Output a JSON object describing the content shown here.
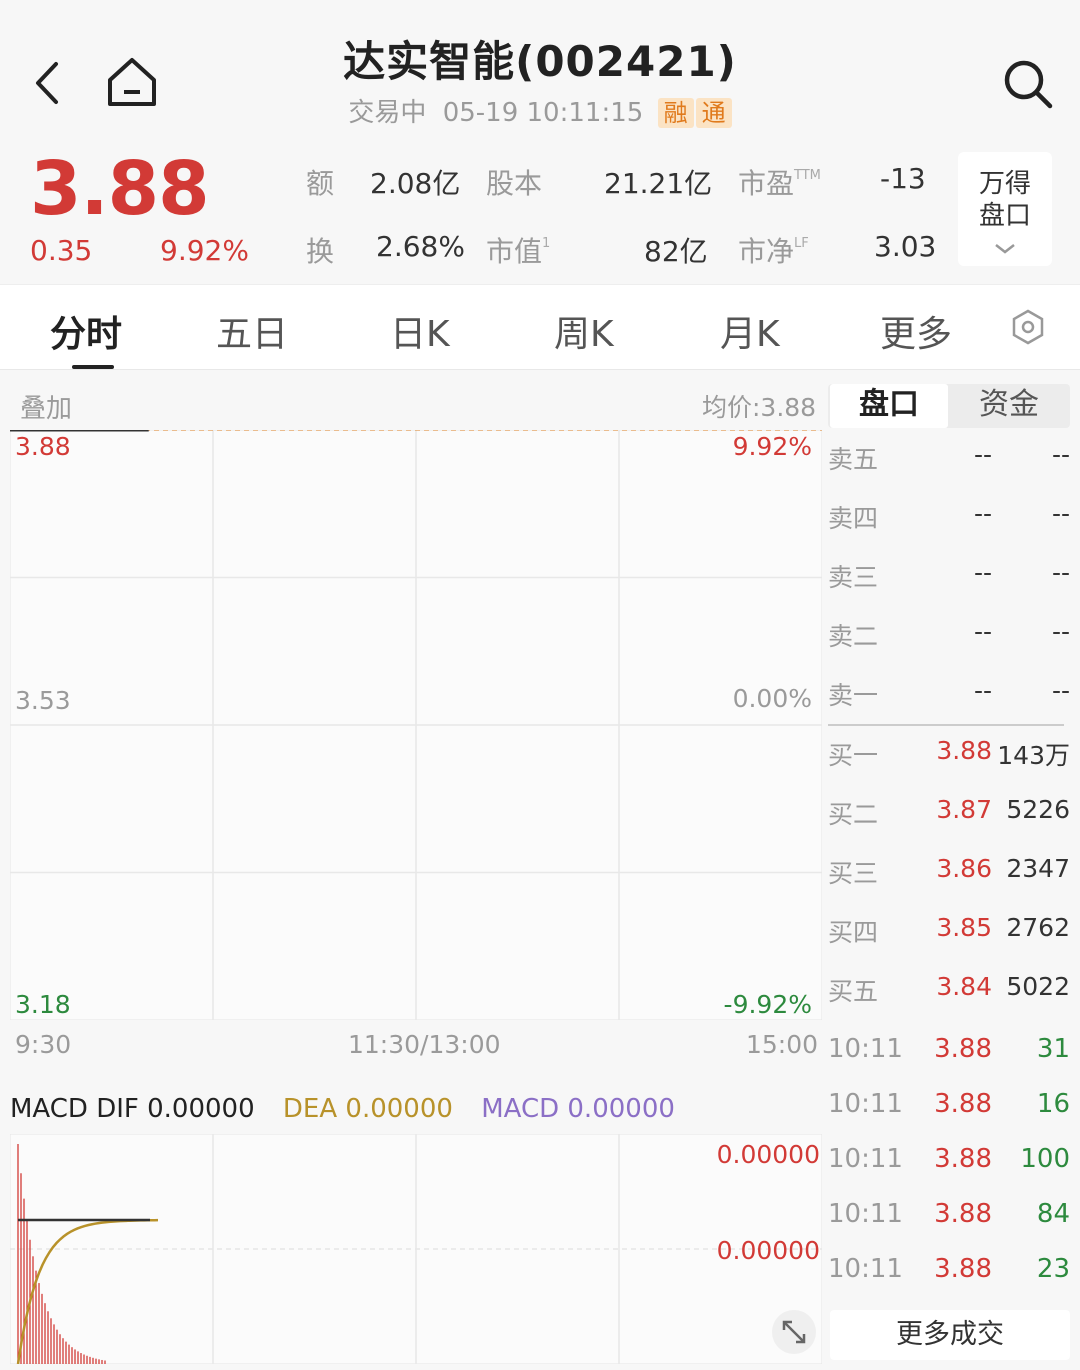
{
  "header": {
    "title": "达实智能(002421)",
    "status": "交易中",
    "datetime": "05-19 10:11:15",
    "tags": [
      "融",
      "通"
    ]
  },
  "quote": {
    "price": "3.88",
    "change": "0.35",
    "change_pct": "9.92%",
    "stats": [
      {
        "label": "额",
        "sup": "",
        "value": "2.08亿"
      },
      {
        "label": "股本",
        "sup": "",
        "value": "21.21亿"
      },
      {
        "label": "市盈",
        "sup": "TTM",
        "value": "-13"
      },
      {
        "label": "换",
        "sup": "",
        "value": "2.68%"
      },
      {
        "label": "市值",
        "sup": "1",
        "value": "82亿"
      },
      {
        "label": "市净",
        "sup": "LF",
        "value": "3.03"
      }
    ],
    "pankou_button": {
      "line1": "万得",
      "line2": "盘口"
    }
  },
  "tabs": [
    "分时",
    "五日",
    "日K",
    "周K",
    "月K",
    "更多"
  ],
  "active_tab": 0,
  "chart_header": {
    "overlay_label": "叠加",
    "avg_price": "均价:3.88"
  },
  "chart_data": {
    "type": "line",
    "y_labels_left": [
      "3.88",
      "3.53",
      "3.18"
    ],
    "y_labels_right": [
      "9.92%",
      "0.00%",
      "-9.92%"
    ],
    "x_labels": [
      "9:30",
      "11:30/13:00",
      "15:00"
    ],
    "ylim": [
      3.18,
      3.88
    ],
    "series": [
      {
        "x": [
          "9:30",
          "10:11"
        ],
        "values": [
          3.88,
          3.88
        ],
        "color": "#333333"
      }
    ],
    "grid": true
  },
  "panel_tabs": [
    "盘口",
    "资金"
  ],
  "order_book": {
    "asks": [
      {
        "label": "卖五",
        "price": "--",
        "volume": "--"
      },
      {
        "label": "卖四",
        "price": "--",
        "volume": "--"
      },
      {
        "label": "卖三",
        "price": "--",
        "volume": "--"
      },
      {
        "label": "卖二",
        "price": "--",
        "volume": "--"
      },
      {
        "label": "卖一",
        "price": "--",
        "volume": "--"
      }
    ],
    "bids": [
      {
        "label": "买一",
        "price": "3.88",
        "volume": "143万"
      },
      {
        "label": "买二",
        "price": "3.87",
        "volume": "5226"
      },
      {
        "label": "买三",
        "price": "3.86",
        "volume": "2347"
      },
      {
        "label": "买四",
        "price": "3.85",
        "volume": "2762"
      },
      {
        "label": "买五",
        "price": "3.84",
        "volume": "5022"
      }
    ]
  },
  "trades": [
    {
      "time": "10:11",
      "price": "3.88",
      "volume": "31"
    },
    {
      "time": "10:11",
      "price": "3.88",
      "volume": "16"
    },
    {
      "time": "10:11",
      "price": "3.88",
      "volume": "100"
    },
    {
      "time": "10:11",
      "price": "3.88",
      "volume": "84"
    },
    {
      "time": "10:11",
      "price": "3.88",
      "volume": "23"
    }
  ],
  "more_trades_label": "更多成交",
  "macd": {
    "dif": "MACD DIF 0.00000",
    "dea": "DEA 0.00000",
    "macd": "MACD 0.00000",
    "scale_top": "0.00000",
    "scale_mid": "0.00000"
  },
  "colors": {
    "up": "#d23a36",
    "down": "#2d8a3e",
    "dea": "#b8922a",
    "macd": "#8b6fc6",
    "dashed": "#e4a86a"
  }
}
